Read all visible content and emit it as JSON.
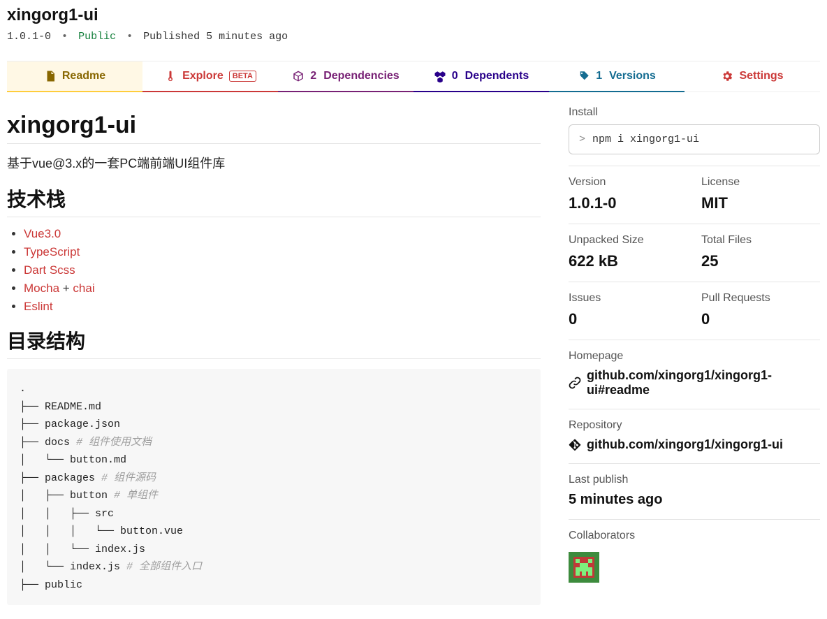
{
  "header": {
    "package_name": "xingorg1-ui",
    "version": "1.0.1-0",
    "visibility": "Public",
    "published": "Published 5 minutes ago"
  },
  "tabs": {
    "readme": {
      "label": "Readme"
    },
    "explore": {
      "label": "Explore",
      "badge": "BETA"
    },
    "dependencies": {
      "count": "2",
      "label": "Dependencies"
    },
    "dependents": {
      "count": "0",
      "label": "Dependents"
    },
    "versions": {
      "count": "1",
      "label": "Versions"
    },
    "settings": {
      "label": "Settings"
    }
  },
  "readme": {
    "h1": "xingorg1-ui",
    "description": "基于vue@3.x的一套PC端前端UI组件库",
    "tech_heading": "技术栈",
    "tech_items": [
      {
        "text": "Vue3.0",
        "suffix": ""
      },
      {
        "text": "TypeScript",
        "suffix": ""
      },
      {
        "text": "Dart Scss",
        "suffix": ""
      },
      {
        "text": "Mocha",
        "suffix_plain": " + ",
        "text2": "chai"
      },
      {
        "text": "Eslint",
        "suffix": ""
      }
    ],
    "dir_heading": "目录结构",
    "tree_lines": [
      {
        "t": "."
      },
      {
        "t": "├── README.md"
      },
      {
        "t": "├── package.json"
      },
      {
        "t": "├── docs ",
        "c": "# 组件使用文档"
      },
      {
        "t": "│   └── button.md"
      },
      {
        "t": "├── packages ",
        "c": "# 组件源码"
      },
      {
        "t": "│   ├── button ",
        "c": "# 单组件"
      },
      {
        "t": "│   │   ├── src"
      },
      {
        "t": "│   │   │   └── button.vue"
      },
      {
        "t": "│   │   └── index.js"
      },
      {
        "t": "│   └── index.js ",
        "c": "# 全部组件入口"
      },
      {
        "t": "├── public"
      }
    ]
  },
  "sidebar": {
    "install": {
      "label": "Install",
      "prompt": ">",
      "command": "npm i xingorg1-ui"
    },
    "version": {
      "label": "Version",
      "value": "1.0.1-0"
    },
    "license": {
      "label": "License",
      "value": "MIT"
    },
    "unpacked_size": {
      "label": "Unpacked Size",
      "value": "622 kB"
    },
    "total_files": {
      "label": "Total Files",
      "value": "25"
    },
    "issues": {
      "label": "Issues",
      "value": "0"
    },
    "pull_requests": {
      "label": "Pull Requests",
      "value": "0"
    },
    "homepage": {
      "label": "Homepage",
      "value": "github.com/xingorg1/xingorg1-ui#readme"
    },
    "repository": {
      "label": "Repository",
      "value": "github.com/xingorg1/xingorg1-ui"
    },
    "last_publish": {
      "label": "Last publish",
      "value": "5 minutes ago"
    },
    "collaborators": {
      "label": "Collaborators"
    }
  }
}
